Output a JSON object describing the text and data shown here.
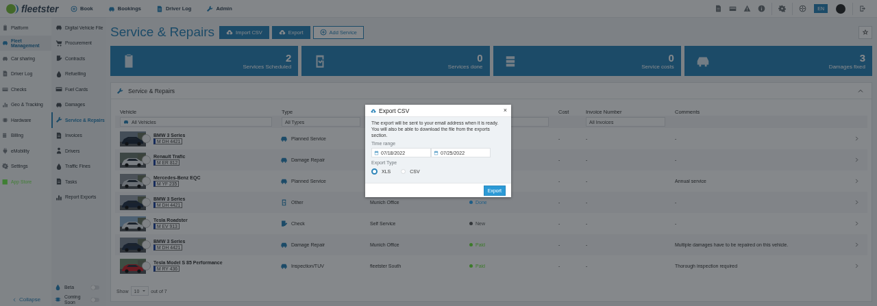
{
  "topbar": {
    "logo": "fleetster",
    "nav": [
      "Book",
      "Bookings",
      "Driver Log",
      "Admin"
    ],
    "language": "EN"
  },
  "sidebar_primary": {
    "items": [
      {
        "label": "Platform",
        "selected": false
      },
      {
        "label": "Fleet Management",
        "selected": true
      },
      {
        "label": "Car sharing",
        "selected": false
      },
      {
        "label": "Driver Log",
        "selected": false
      },
      {
        "label": "Checks",
        "selected": false
      },
      {
        "label": "Geo & Tracking",
        "selected": false
      },
      {
        "label": "Hardware",
        "selected": false
      },
      {
        "label": "Billing",
        "selected": false
      },
      {
        "label": "eMobility",
        "selected": false
      },
      {
        "label": "Settings",
        "selected": false
      },
      {
        "label": "App Store",
        "selected": false,
        "color": "#3f7f33"
      }
    ],
    "collapse": "Collapse"
  },
  "sidebar_secondary": {
    "items": [
      {
        "label": "Digital Vehicle File",
        "selected": false
      },
      {
        "label": "Procurement",
        "selected": false
      },
      {
        "label": "Contracts",
        "selected": false
      },
      {
        "label": "Refuelling",
        "selected": false
      },
      {
        "label": "Fuel Cards",
        "selected": false
      },
      {
        "label": "Damages",
        "selected": false
      },
      {
        "label": "Service & Repairs",
        "selected": true
      },
      {
        "label": "Invoices",
        "selected": false
      },
      {
        "label": "Drivers",
        "selected": false
      },
      {
        "label": "Traffic Fines",
        "selected": false
      },
      {
        "label": "Tasks",
        "selected": false
      },
      {
        "label": "Report Exports",
        "selected": false
      }
    ],
    "toggles": [
      {
        "label": "Beta",
        "on": false
      },
      {
        "label": "Coming Soon",
        "on": false
      }
    ]
  },
  "page": {
    "title": "Service & Repairs",
    "buttons": [
      "Import CSV",
      "Export"
    ],
    "add_button": "Add Service"
  },
  "stats": [
    {
      "value": "2",
      "label": "Services Scheduled"
    },
    {
      "value": "0",
      "label": "Services done"
    },
    {
      "value": "0",
      "label": "Service costs"
    },
    {
      "value": "3",
      "label": "Damages fixed"
    }
  ],
  "panel": {
    "title": "Service & Repairs",
    "columns": {
      "vehicle": "Vehicle",
      "type": "Type",
      "cost": "Cost",
      "invoice": "Invoice Number",
      "comments": "Comments"
    },
    "filters": {
      "vehicle": "All Vehicles",
      "type": "All Types",
      "invoice": "All Invoices"
    },
    "rows": [
      {
        "vehicle": "BMW 3 Series",
        "plate": "M DH 4421",
        "type": "Planned Service",
        "cost": "-",
        "invoice": "-",
        "comments": "-"
      },
      {
        "vehicle": "Renault Trafic",
        "plate": "M ER 812",
        "type": "Damage Repair",
        "cost": "-",
        "invoice": "-",
        "comments": "-"
      },
      {
        "vehicle": "Mercedes-Benz EQC",
        "plate": "M YF 235",
        "type": "Planned Service",
        "cost": "-",
        "invoice": "-",
        "comments": "Annual service"
      },
      {
        "vehicle": "BMW 3 Series",
        "plate": "M DH 4421",
        "type": "Other",
        "location": "Munich Office",
        "status": {
          "label": "Done",
          "color": "#1e5d86"
        },
        "cost": "-",
        "invoice": "-",
        "comments": "-"
      },
      {
        "vehicle": "Tesla Roadster",
        "plate": "M EV 913",
        "type": "Check",
        "location": "Self Service",
        "status": {
          "label": "New",
          "color": "#33373a"
        },
        "cost": "-",
        "invoice": "-",
        "comments": "-"
      },
      {
        "vehicle": "BMW 3 Series",
        "plate": "M DH 4421",
        "type": "Damage Repair",
        "location": "Munich Office",
        "status": {
          "label": "Paid",
          "color": "#3c7a2a"
        },
        "cost": "-",
        "invoice": "-",
        "comments": "Multiple damages have to be repaired on this vehicle."
      },
      {
        "vehicle": "Tesla Model S 85 Performance",
        "plate": "M RY 436",
        "type": "Inspection/TUV",
        "location": "fleetster South",
        "status": {
          "label": "Paid",
          "color": "#3c7a2a"
        },
        "cost": "-",
        "invoice": "-",
        "comments": "Thorough inspection required"
      }
    ],
    "footer": {
      "show": "Show",
      "page_size": "10",
      "total": "out of 7"
    }
  },
  "modal": {
    "title": "Export CSV",
    "close": "×",
    "message": "The export will be sent to your email address when it is ready. You will also be able to download the file from the exports section.",
    "time_label": "Time range",
    "from": "07/18/2022",
    "to": "07/25/2022",
    "type_label": "Export Type",
    "options": [
      {
        "label": "XLS",
        "selected": true
      },
      {
        "label": "CSV",
        "selected": false
      }
    ],
    "button": "Export"
  }
}
